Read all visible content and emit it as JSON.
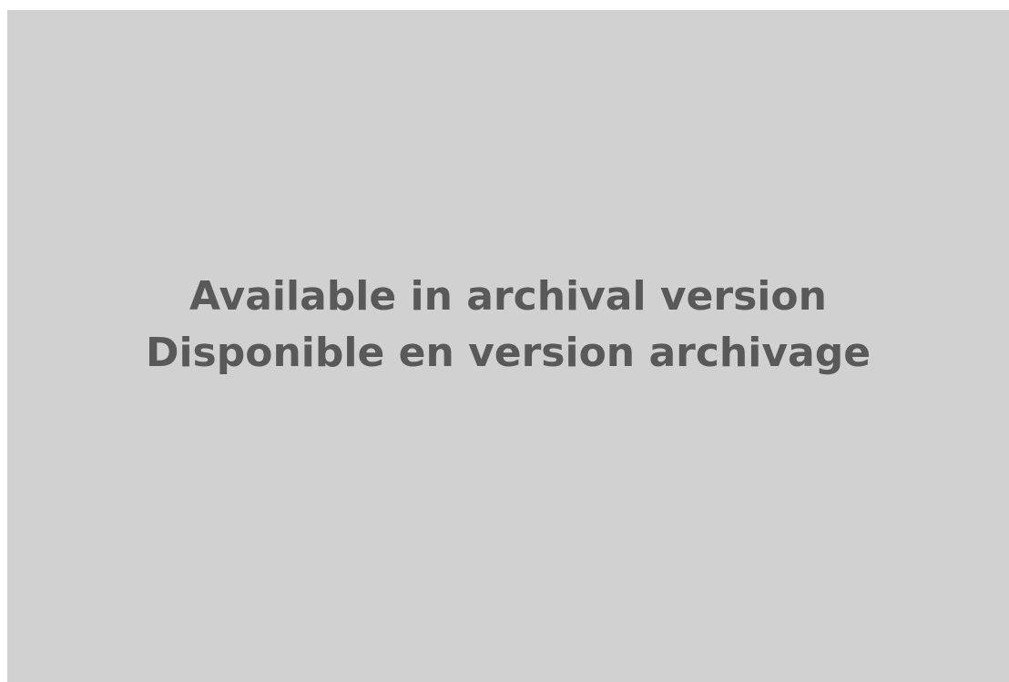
{
  "placeholder": {
    "line_en": "Available in archival version",
    "line_fr": "Disponible en version archivage",
    "background_color": "#d1d1d1",
    "text_color": "#595959"
  }
}
